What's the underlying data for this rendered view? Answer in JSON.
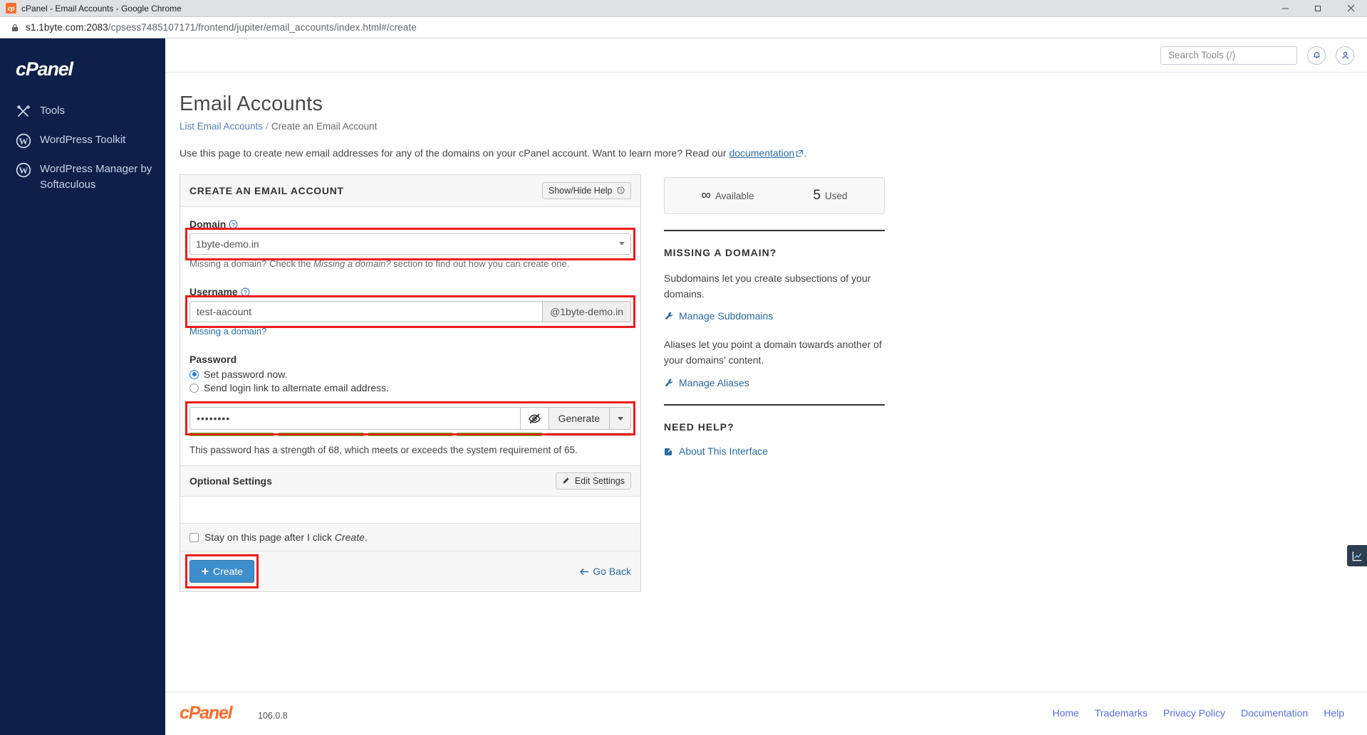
{
  "window": {
    "title": "cPanel - Email Accounts - Google Chrome",
    "favicon": "cp",
    "minimize": "minimize-icon",
    "maximize": "restore-icon",
    "close": "close-icon"
  },
  "urlbar": {
    "lock": "lock-icon",
    "host": "s1.1byte.com:2083",
    "path": "/cpsess7485107171/frontend/jupiter/email_accounts/index.html#/create"
  },
  "sidebar": {
    "brand": "cPanel",
    "items": [
      {
        "label": "Tools",
        "icon": "tools-icon"
      },
      {
        "label": "WordPress Toolkit",
        "icon": "wordpress-icon"
      },
      {
        "label": "WordPress Manager by Softaculous",
        "icon": "wordpress-icon"
      }
    ]
  },
  "topbar": {
    "search_placeholder": "Search Tools (/)",
    "search_value": "",
    "search_icon": "search-icon",
    "notifications_icon": "bell-icon",
    "user_icon": "user-icon"
  },
  "page": {
    "title": "Email Accounts",
    "breadcrumb": {
      "parent": "List Email Accounts",
      "separator": "/",
      "current": "Create an Email Account"
    },
    "intro_before": "Use this page to create new email addresses for any of the domains on your cPanel account. Want to learn more? Read our ",
    "intro_link": "documentation",
    "intro_after": "."
  },
  "form": {
    "panel_title": "CREATE AN EMAIL ACCOUNT",
    "show_hide_help": "Show/Hide Help",
    "domain": {
      "label": "Domain",
      "value": "1byte-demo.in",
      "options": [
        "1byte-demo.in"
      ],
      "hint_before": "Missing a domain? Check the ",
      "hint_italic": "Missing a domain?",
      "hint_after": " section to find out how you can create one."
    },
    "username": {
      "label": "Username",
      "value": "test-aacount",
      "placeholder": "",
      "addon": "@1byte-demo.in",
      "missing_link": "Missing a domain?"
    },
    "password": {
      "label": "Password",
      "option_set_now": "Set password now.",
      "option_send_link": "Send login link to alternate email address.",
      "selected": "set_now",
      "value": "••••••••",
      "toggle_icon": "eye-slash-icon",
      "generate_label": "Generate",
      "caret_icon": "chevron-down-icon",
      "strength_segments_on": 4,
      "strength_segments_total": 5,
      "strength_text": "This password has a strength of 68, which meets or exceeds the system requirement of 65.",
      "strength_color": "#5ec228"
    },
    "optional": {
      "title": "Optional Settings",
      "edit_label": "Edit Settings",
      "edit_icon": "pencil-icon"
    },
    "stay": {
      "label_before": "Stay on this page after I click ",
      "label_italic": "Create",
      "label_after": ".",
      "checked": false
    },
    "create_button": "Create",
    "create_icon": "plus-icon",
    "go_back": "Go Back",
    "go_back_icon": "arrow-left-icon"
  },
  "aside": {
    "usage": {
      "available_value": "∞",
      "available_label": "Available",
      "used_value": "5",
      "used_label": "Used"
    },
    "missing_domain": {
      "title": "MISSING A DOMAIN?",
      "p1": "Subdomains let you create subsections of your domains.",
      "link1": "Manage Subdomains",
      "p2": "Aliases let you point a domain towards another of your domains’ content.",
      "link2": "Manage Aliases",
      "link_icon": "wrench-icon"
    },
    "need_help": {
      "title": "NEED HELP?",
      "link": "About This Interface",
      "link_icon": "external-link-icon"
    }
  },
  "footer": {
    "brand": "cPanel",
    "version": "106.0.8",
    "links": [
      "Home",
      "Trademarks",
      "Privacy Policy",
      "Documentation",
      "Help"
    ]
  },
  "side_tab": {
    "icon": "chart-icon"
  },
  "colors": {
    "sidebar_bg": "#0e2049",
    "accent_blue": "#3e8ecb",
    "link_blue": "#2c6aa0",
    "brand_orange": "#ff6c2c",
    "highlight_red": "#ee1c1c",
    "strength_green": "#5ec228"
  }
}
